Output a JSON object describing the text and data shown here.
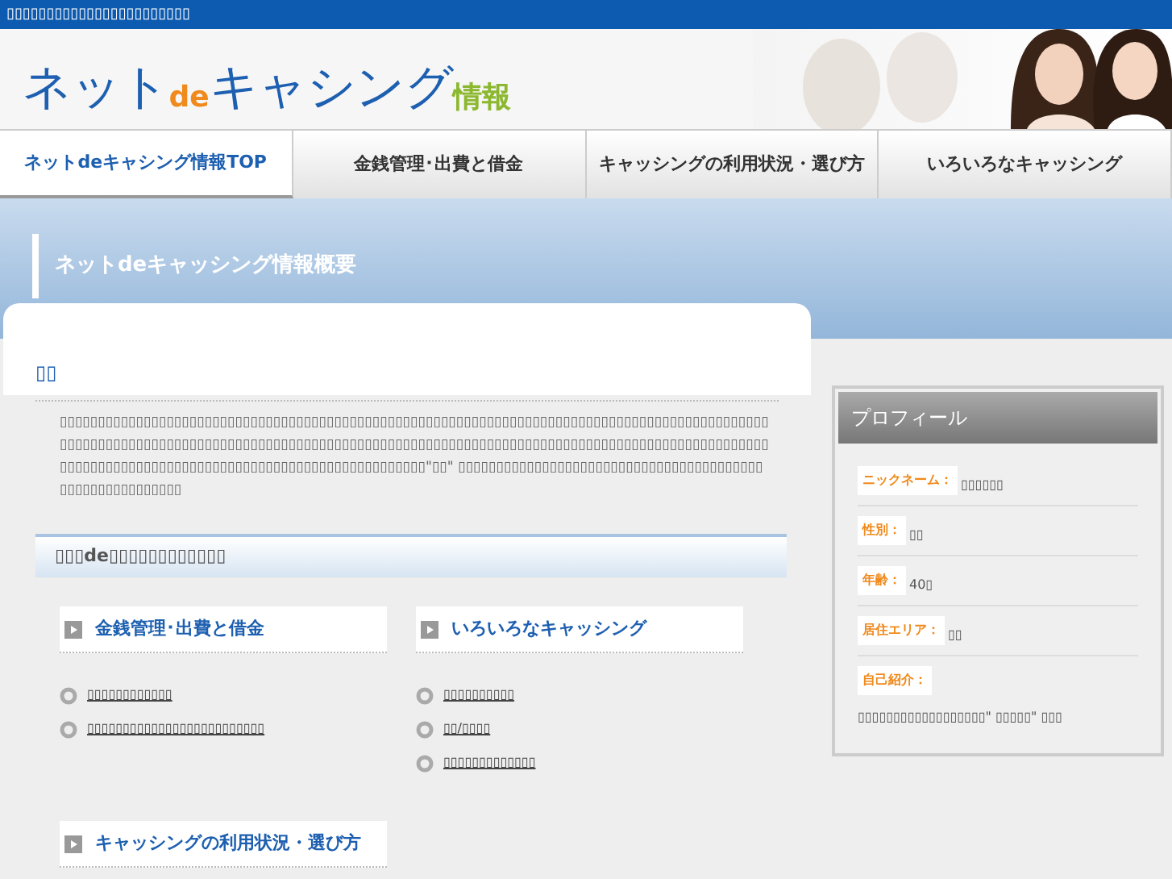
{
  "top_bar": {
    "text": "▯▯▯▯▯▯▯▯▯▯▯▯▯▯▯▯▯▯▯▯▯▯▯"
  },
  "logo": {
    "parts": [
      {
        "text": "ネット",
        "kind": "main"
      },
      {
        "text": "de",
        "kind": "accent"
      },
      {
        "text": "キャシング",
        "kind": "main"
      },
      {
        "text": "情報",
        "kind": "sub"
      }
    ]
  },
  "nav_tabs": [
    {
      "label": "ネットdeキャシング情報TOP",
      "selected": true
    },
    {
      "label": "金銭管理･出費と借金",
      "selected": false
    },
    {
      "label": "キャッシングの利用状況・選び方",
      "selected": false
    },
    {
      "label": "いろいろなキャッシング",
      "selected": false
    }
  ],
  "banner": {
    "title": "ネットdeキャッシング情報概要"
  },
  "article": {
    "heading": "▯▯",
    "body": "▯▯▯▯▯▯▯▯▯▯▯▯▯▯▯▯▯▯▯▯▯▯▯▯▯▯▯▯▯▯▯▯▯▯▯▯▯▯▯▯▯▯▯▯▯▯▯▯▯▯▯▯▯▯▯▯▯▯▯▯▯▯▯▯▯▯▯▯▯▯▯▯▯▯▯▯▯▯▯▯▯▯▯▯▯▯▯▯▯▯▯▯▯▯▯▯▯▯▯▯▯▯▯▯▯▯▯▯▯▯▯▯▯▯▯▯▯▯▯▯▯▯▯▯▯▯▯▯▯▯▯▯▯▯▯▯▯▯▯▯▯▯▯▯▯▯▯▯▯▯▯▯▯▯▯▯▯▯▯▯▯▯▯▯▯▯▯▯▯▯▯▯▯▯▯▯▯▯▯▯▯▯▯▯▯▯▯▯▯▯▯▯▯▯▯▯▯▯▯▯▯▯▯▯▯▯▯▯▯▯▯▯▯▯▯▯▯▯▯▯▯▯▯▯▯▯▯▯▯▯▯▯▯▯\"▯▯\" ▯▯▯▯▯▯▯▯▯▯▯▯▯▯▯▯▯▯▯▯▯▯▯▯▯▯▯▯▯▯▯▯▯▯▯▯▯▯▯▯▯▯▯▯▯▯▯▯▯▯▯▯▯▯▯▯"
  },
  "site_map": {
    "title": "▯▯▯de▯▯▯▯▯▯▯▯▯▯▯▯",
    "categories": [
      {
        "title": "金銭管理･出費と借金",
        "links": [
          "▯▯▯▯▯▯▯▯▯▯▯▯",
          "▯▯▯▯▯▯▯▯▯▯▯▯▯▯▯▯▯▯▯▯▯▯▯▯▯"
        ]
      },
      {
        "title": "いろいろなキャッシング",
        "links": [
          "▯▯▯▯▯▯▯▯▯▯",
          "▯▯/▯▯▯▯",
          "▯▯▯▯▯▯▯▯▯▯▯▯▯"
        ]
      },
      {
        "title": "キャッシングの利用状況・選び方"
      }
    ]
  },
  "profile": {
    "title": "プロフィール",
    "fields": [
      {
        "label": "ニックネーム：",
        "value": "▯▯▯▯▯▯"
      },
      {
        "label": "性別：",
        "value": "▯▯"
      },
      {
        "label": "年齢：",
        "value": "40▯"
      },
      {
        "label": "居住エリア：",
        "value": "▯▯"
      },
      {
        "label": "自己紹介：",
        "value": "▯▯▯▯▯▯▯▯▯▯▯▯▯▯▯▯▯▯\" ▯▯▯▯▯\" ▯▯▯"
      }
    ]
  }
}
